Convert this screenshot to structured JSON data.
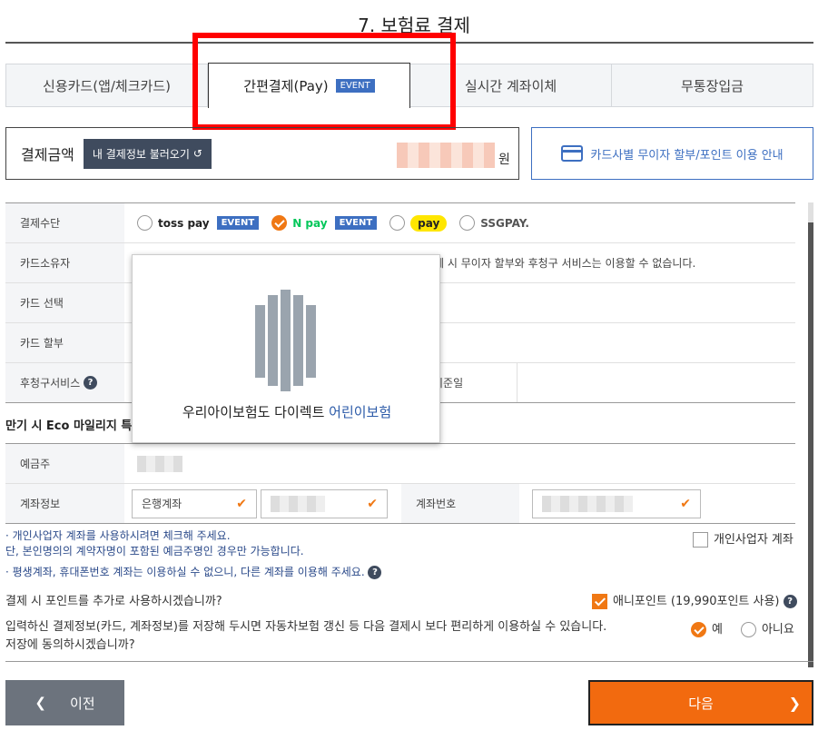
{
  "page_title": "7. 보험료 결제",
  "tabs": [
    {
      "label": "신용카드(앱/체크카드)"
    },
    {
      "label": "간편결제(Pay)",
      "badge": "EVENT"
    },
    {
      "label": "실시간 계좌이체"
    },
    {
      "label": "무통장입금"
    }
  ],
  "amount": {
    "label": "결제금액",
    "load_button": "내 결제정보 불러오기",
    "unit": "원"
  },
  "card_info_link": "카드사별 무이자 할부/포인트 이용 안내",
  "form": {
    "payment_method_label": "결제수단",
    "pay_options": [
      {
        "name": "toss pay",
        "badge": "EVENT",
        "checked": false
      },
      {
        "name": "N pay",
        "badge": "EVENT",
        "checked": true
      },
      {
        "name": "pay",
        "badge": "",
        "checked": false
      },
      {
        "name": "SSGPAY.",
        "badge": "",
        "checked": false
      }
    ],
    "card_owner_label": "카드소유자",
    "card_owner_note": "결제 시 무이자 할부와 후청구 서비스는 이용할 수 없습니다.",
    "card_select_label": "카드 선택",
    "installment_label": "카드 할부",
    "postpay_label": "후청구서비스",
    "base_date_label": "기준일"
  },
  "popup": {
    "text_prefix": "우리아이보험도 다이렉트 ",
    "text_highlight": "어린이보험"
  },
  "eco_label": "만기 시 Eco 마일리지 특",
  "account": {
    "holder_label": "예금주",
    "info_label": "계좌정보",
    "info_select": "은행계좌",
    "number_label": "계좌번호"
  },
  "notes": {
    "line1": "· 개인사업자 계좌를 사용하시려면 체크해 주세요.",
    "line2": "  단, 본인명의의 계약자명이 포함된 예금주명인 경우만 가능합니다.",
    "line3": "· 평생계좌, 휴대폰번호 계좌는 이용하실 수 없으니, 다른 계좌를 이용해 주세요.",
    "business_checkbox": "개인사업자 계좌"
  },
  "points": {
    "question": "결제 시 포인트를 추가로 사용하시겠습니까?",
    "option": "애니포인트 (19,990포인트 사용)",
    "checked": true
  },
  "save_consent": {
    "line1": "입력하신 결제정보(카드, 계좌정보)를 저장해 두시면 자동차보험 갱신 등 다음 결제시 보다 편리하게 이용하실 수 있습니다.",
    "line2": "저장에 동의하시겠습니까?",
    "yes": "예",
    "no": "아니요",
    "selected": "yes"
  },
  "nav": {
    "prev": "이전",
    "next": "다음"
  },
  "colors": {
    "accent": "#f26a0f",
    "blue": "#3d6fc1",
    "dark": "#3f4b5e"
  }
}
